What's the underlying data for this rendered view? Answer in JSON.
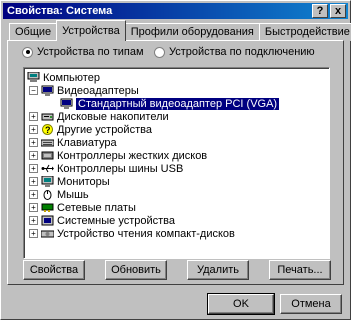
{
  "window": {
    "title": "Свойства: Система",
    "help_label": "?",
    "close_label": "x"
  },
  "tabs": [
    {
      "label": "Общие"
    },
    {
      "label": "Устройства"
    },
    {
      "label": "Профили оборудования"
    },
    {
      "label": "Быстродействие"
    }
  ],
  "view": {
    "by_type_label": "Устройства по типам",
    "by_connection_label": "Устройства по подключению",
    "selected": "by_type"
  },
  "tree": {
    "root": "Компьютер",
    "expanded_category": "Видеоадаптеры",
    "selected_device": "Стандартный видеоадаптер PCI (VGA)",
    "categories": [
      "Дисковые накопители",
      "Другие устройства",
      "Клавиатура",
      "Контроллеры жестких дисков",
      "Контроллеры шины USB",
      "Мониторы",
      "Мышь",
      "Сетевые платы",
      "Системные устройства",
      "Устройство чтения компакт-дисков"
    ],
    "expand_symbol": "+",
    "collapse_symbol": "−"
  },
  "buttons": {
    "properties": "Свойства",
    "refresh": "Обновить",
    "remove": "Удалить",
    "print": "Печать...",
    "ok": "OK",
    "cancel": "Отмена"
  },
  "icons": {
    "computer": "computer-icon",
    "display": "display-adapter-icon",
    "disk": "disk-drive-icon",
    "unknown": "question-mark-icon",
    "keyboard": "keyboard-icon",
    "hdd_controller": "hdd-controller-icon",
    "usb": "usb-icon",
    "monitor": "monitor-icon",
    "mouse": "mouse-icon",
    "network": "network-card-icon",
    "system": "system-device-icon",
    "cdrom": "cdrom-icon"
  }
}
